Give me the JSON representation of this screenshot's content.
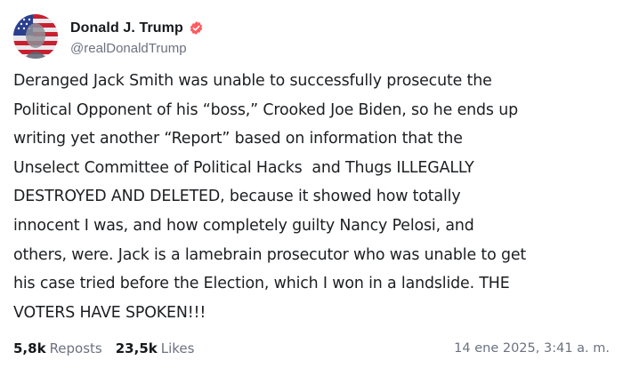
{
  "author": {
    "display_name": "Donald J. Trump",
    "handle": "@realDonaldTrump",
    "verified_color": "#ff5a5f"
  },
  "post": {
    "text": "Deranged Jack Smith was unable to successfully prosecute the\nPolitical Opponent of his “boss,” Crooked Joe Biden, so he ends up\nwriting yet another “Report” based on information that the\nUnselect Committee of Political Hacks  and Thugs ILLEGALLY\nDESTROYED AND DELETED, because it showed how totally\ninnocent I was, and how completely guilty Nancy Pelosi, and\nothers, were. Jack is a lamebrain prosecutor who was unable to get\nhis case tried before the Election, which I won in a landslide. THE\nVOTERS HAVE SPOKEN!!!"
  },
  "stats": {
    "reposts_count": "5,8k",
    "reposts_label": "Reposts",
    "likes_count": "23,5k",
    "likes_label": "Likes"
  },
  "timestamp": "14 ene 2025, 3:41 a. m.",
  "icons": {
    "verified": "verified-badge-icon",
    "avatar": "avatar-image"
  }
}
